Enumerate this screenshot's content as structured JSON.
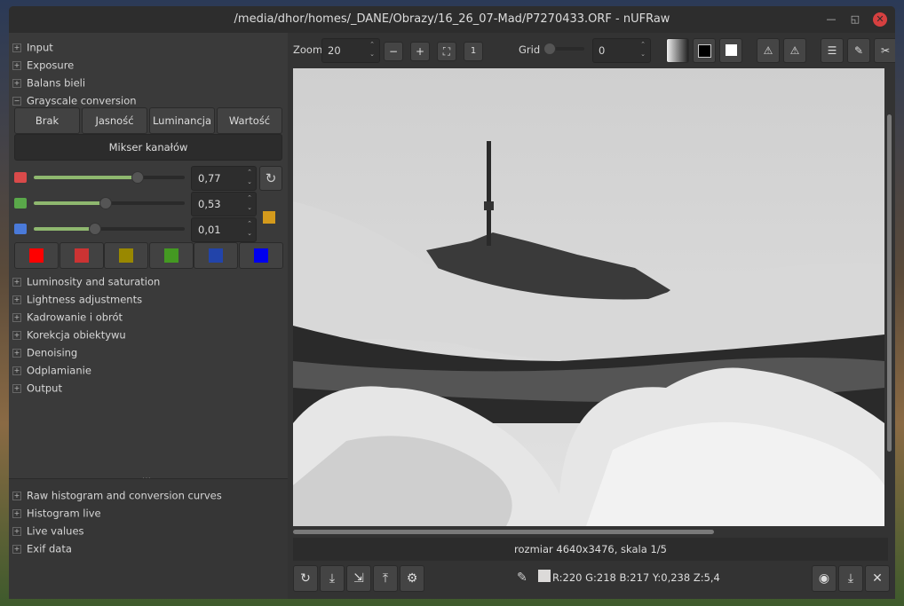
{
  "window": {
    "title": "/media/dhor/homes/_DANE/Obrazy/16_26_07-Mad/P7270433.ORF - nUFRaw"
  },
  "panels": {
    "top": [
      {
        "label": "Input",
        "sign": "+"
      },
      {
        "label": "Exposure",
        "sign": "+"
      },
      {
        "label": "Balans bieli",
        "sign": "+"
      },
      {
        "label": "Grayscale conversion",
        "sign": "−"
      }
    ],
    "grayscale": {
      "modes": [
        "Brak",
        "Jasność",
        "Luminancja",
        "Wartość"
      ],
      "mixer_label": "Mikser kanałów",
      "sliders": [
        {
          "name": "red",
          "value": "0,77",
          "level": 0.77,
          "color": "#d94a4a"
        },
        {
          "name": "green",
          "value": "0,53",
          "level": 0.53,
          "color": "#5aa84a"
        },
        {
          "name": "blue",
          "value": "0,01",
          "level": 0.01,
          "color": "#4a7ad9"
        }
      ],
      "preview_color": "#d49a1c",
      "color_buttons": [
        "#ff0000",
        "#cc3333",
        "#998800",
        "#449922",
        "#2244aa",
        "#0000ee"
      ]
    },
    "middle": [
      {
        "label": "Luminosity and saturation",
        "sign": "+"
      },
      {
        "label": "Lightness adjustments",
        "sign": "+"
      },
      {
        "label": "Kadrowanie i obrót",
        "sign": "+"
      },
      {
        "label": "Korekcja obiektywu",
        "sign": "+"
      },
      {
        "label": "Denoising",
        "sign": "+"
      },
      {
        "label": "Odplamianie",
        "sign": "+"
      },
      {
        "label": "Output",
        "sign": "+"
      }
    ],
    "bottom": [
      {
        "label": "Raw histogram and conversion curves",
        "sign": "+"
      },
      {
        "label": "Histogram live",
        "sign": "+"
      },
      {
        "label": "Live values",
        "sign": "+"
      },
      {
        "label": "Exif data",
        "sign": "+"
      }
    ]
  },
  "toolbar": {
    "zoom_label": "Zoom",
    "zoom_value": "20",
    "grid_label": "Grid",
    "grid_value": "0"
  },
  "status": {
    "size_text": "rozmiar 4640x3476, skala 1/5"
  },
  "pixel": {
    "info": "R:220 G:218 B:217 Y:0,238 Z:5,4"
  },
  "icons": {
    "reset": "refresh-icon",
    "save": "save-icon",
    "export": "export-icon",
    "upload": "upload-icon",
    "settings": "settings-icon"
  }
}
